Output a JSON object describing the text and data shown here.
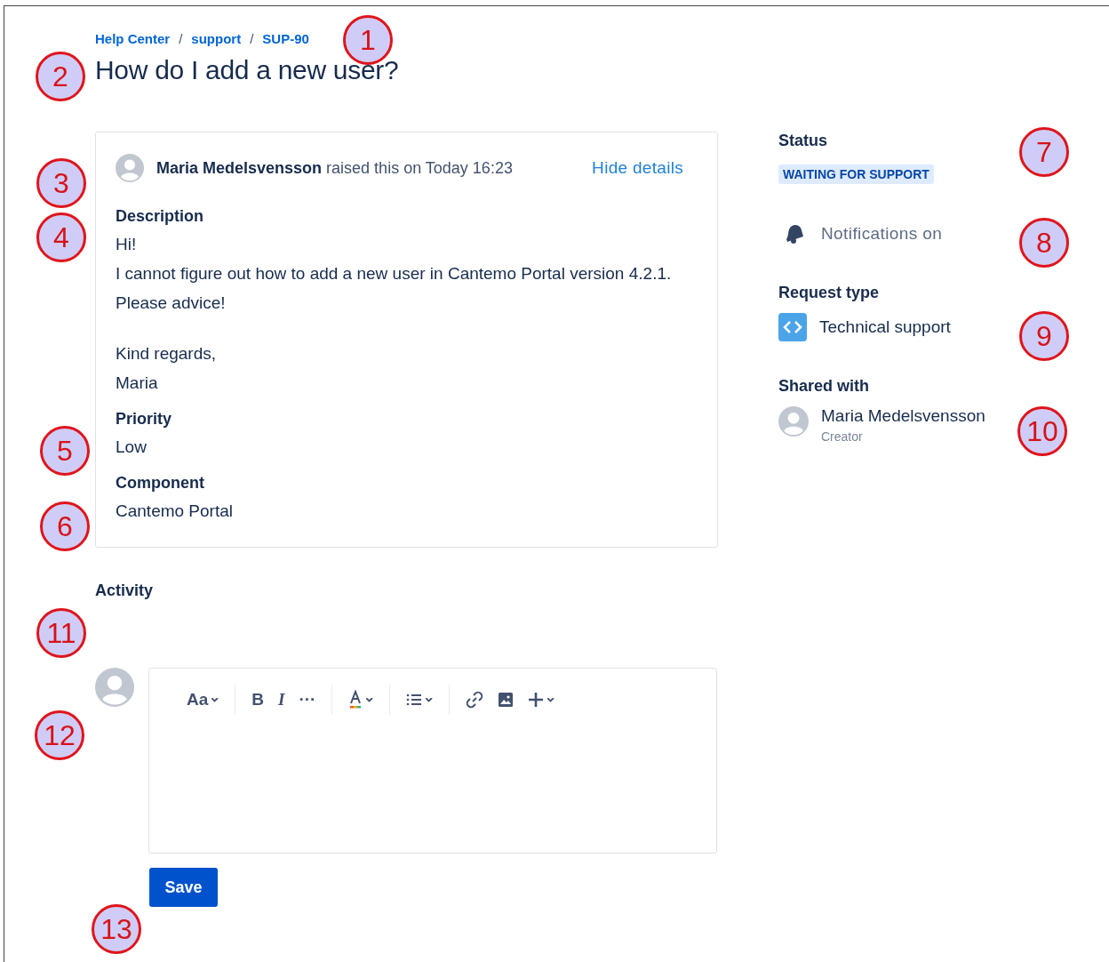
{
  "breadcrumbs": [
    "Help Center",
    "support",
    "SUP-90"
  ],
  "breadcrumb_separator": "/",
  "title": "How do I add a new user?",
  "request": {
    "author": "Maria Medelsvensson",
    "raised_text": "raised this on Today 16:23",
    "toggle": "Hide details",
    "fields": [
      {
        "label": "Description",
        "paragraphs": [
          [
            "Hi!",
            "I cannot figure out how to add a new user in Cantemo Portal version 4.2.1.",
            "Please advice!"
          ],
          [
            "Kind regards,",
            "Maria"
          ]
        ]
      },
      {
        "label": "Priority",
        "paragraphs": [
          [
            "Low"
          ]
        ]
      },
      {
        "label": "Component",
        "paragraphs": [
          [
            "Cantemo Portal"
          ]
        ]
      }
    ]
  },
  "activity": {
    "heading": "Activity"
  },
  "editor": {
    "toolbar": [
      {
        "kind": "text-style",
        "label": "Aa"
      },
      {
        "kind": "divider"
      },
      {
        "kind": "bold",
        "label": "B"
      },
      {
        "kind": "italic",
        "label": "I"
      },
      {
        "kind": "more",
        "label": "···"
      },
      {
        "kind": "divider"
      },
      {
        "kind": "text-color"
      },
      {
        "kind": "divider"
      },
      {
        "kind": "list"
      },
      {
        "kind": "divider"
      },
      {
        "kind": "link"
      },
      {
        "kind": "image"
      },
      {
        "kind": "insert"
      }
    ],
    "save": "Save"
  },
  "sidebar": {
    "status_label": "Status",
    "status": "WAITING FOR SUPPORT",
    "notifications": "Notifications on",
    "request_type_label": "Request type",
    "request_type": "Technical support",
    "shared_label": "Shared with",
    "shared": [
      {
        "name": "Maria Medelsvensson",
        "role": "Creator"
      }
    ]
  },
  "callouts": [
    "1",
    "2",
    "3",
    "4",
    "5",
    "6",
    "7",
    "8",
    "9",
    "10",
    "11",
    "12",
    "13"
  ]
}
